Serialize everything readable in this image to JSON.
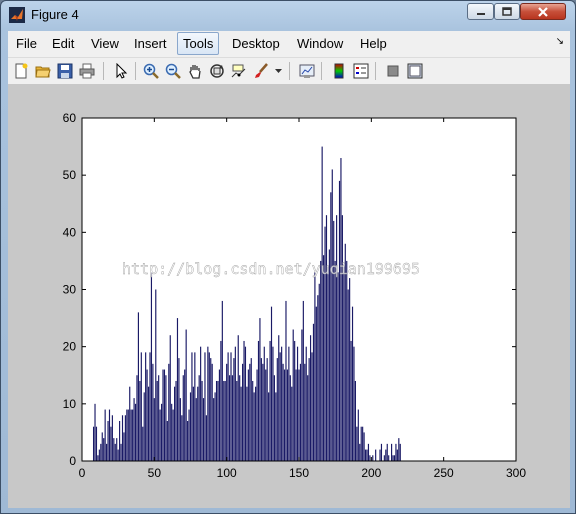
{
  "window": {
    "title": "Figure 4"
  },
  "menu": [
    {
      "label": "File"
    },
    {
      "label": "Edit"
    },
    {
      "label": "View"
    },
    {
      "label": "Insert"
    },
    {
      "label": "Tools"
    },
    {
      "label": "Desktop"
    },
    {
      "label": "Window"
    },
    {
      "label": "Help"
    }
  ],
  "toolbar": [
    {
      "icon": "new-figure-icon"
    },
    {
      "icon": "open-file-icon"
    },
    {
      "icon": "save-icon"
    },
    {
      "icon": "print-icon"
    },
    {
      "icon": "edit-plot-arrow-icon"
    },
    {
      "icon": "zoom-in-icon"
    },
    {
      "icon": "zoom-out-icon"
    },
    {
      "icon": "pan-hand-icon"
    },
    {
      "icon": "rotate-3d-icon"
    },
    {
      "icon": "data-cursor-icon"
    },
    {
      "icon": "brush-icon"
    },
    {
      "icon": "link-plot-icon"
    },
    {
      "icon": "insert-colorbar-icon"
    },
    {
      "icon": "insert-legend-icon"
    },
    {
      "icon": "hide-plot-tools-icon"
    },
    {
      "icon": "show-plot-tools-icon"
    }
  ],
  "watermark": "http://blog.csdn.net/yuqian199695",
  "colors": {
    "bar": "#1a1a66",
    "plot_bg": "#ffffff",
    "figure_bg": "#c8c8c8"
  },
  "chart_data": {
    "type": "bar",
    "xlim": [
      0,
      300
    ],
    "ylim": [
      0,
      60
    ],
    "xticks": [
      0,
      50,
      100,
      150,
      200,
      250,
      300
    ],
    "yticks": [
      0,
      10,
      20,
      30,
      40,
      50,
      60
    ],
    "grid": false,
    "x_start": 1,
    "values": [
      0,
      0,
      0,
      0,
      0,
      0,
      0,
      6,
      10,
      6,
      1,
      2,
      3,
      5,
      4,
      9,
      3,
      7,
      9,
      6,
      8,
      4,
      3,
      4,
      2,
      7,
      3,
      8,
      5,
      8,
      9,
      9,
      13,
      9,
      9,
      11,
      10,
      15,
      26,
      14,
      19,
      6,
      12,
      19,
      16,
      13,
      19,
      33,
      17,
      11,
      30,
      14,
      15,
      9,
      10,
      16,
      16,
      15,
      7,
      17,
      22,
      10,
      9,
      13,
      14,
      25,
      18,
      11,
      8,
      15,
      16,
      23,
      7,
      9,
      12,
      19,
      13,
      19,
      11,
      13,
      15,
      20,
      14,
      11,
      19,
      8,
      20,
      19,
      18,
      17,
      11,
      12,
      14,
      14,
      16,
      21,
      28,
      14,
      14,
      17,
      19,
      15,
      19,
      15,
      18,
      20,
      14,
      22,
      15,
      13,
      17,
      21,
      20,
      13,
      16,
      17,
      18,
      14,
      12,
      13,
      16,
      21,
      25,
      18,
      17,
      20,
      16,
      18,
      12,
      21,
      27,
      20,
      15,
      12,
      18,
      22,
      19,
      20,
      17,
      16,
      28,
      16,
      20,
      15,
      13,
      23,
      21,
      16,
      20,
      16,
      17,
      23,
      28,
      17,
      20,
      15,
      18,
      22,
      19,
      24,
      33,
      27,
      29,
      31,
      35,
      55,
      36,
      41,
      43,
      34,
      37,
      47,
      51,
      42,
      35,
      43,
      33,
      49,
      53,
      43,
      34,
      38,
      35,
      30,
      32,
      21,
      27,
      20,
      14,
      6,
      9,
      3,
      6,
      6,
      5,
      2,
      2,
      3,
      1,
      0,
      1,
      0,
      2,
      0,
      0,
      2,
      3,
      0,
      1,
      2,
      3,
      1,
      0,
      3,
      1,
      1,
      3,
      2,
      4,
      3,
      0,
      0,
      0
    ]
  }
}
